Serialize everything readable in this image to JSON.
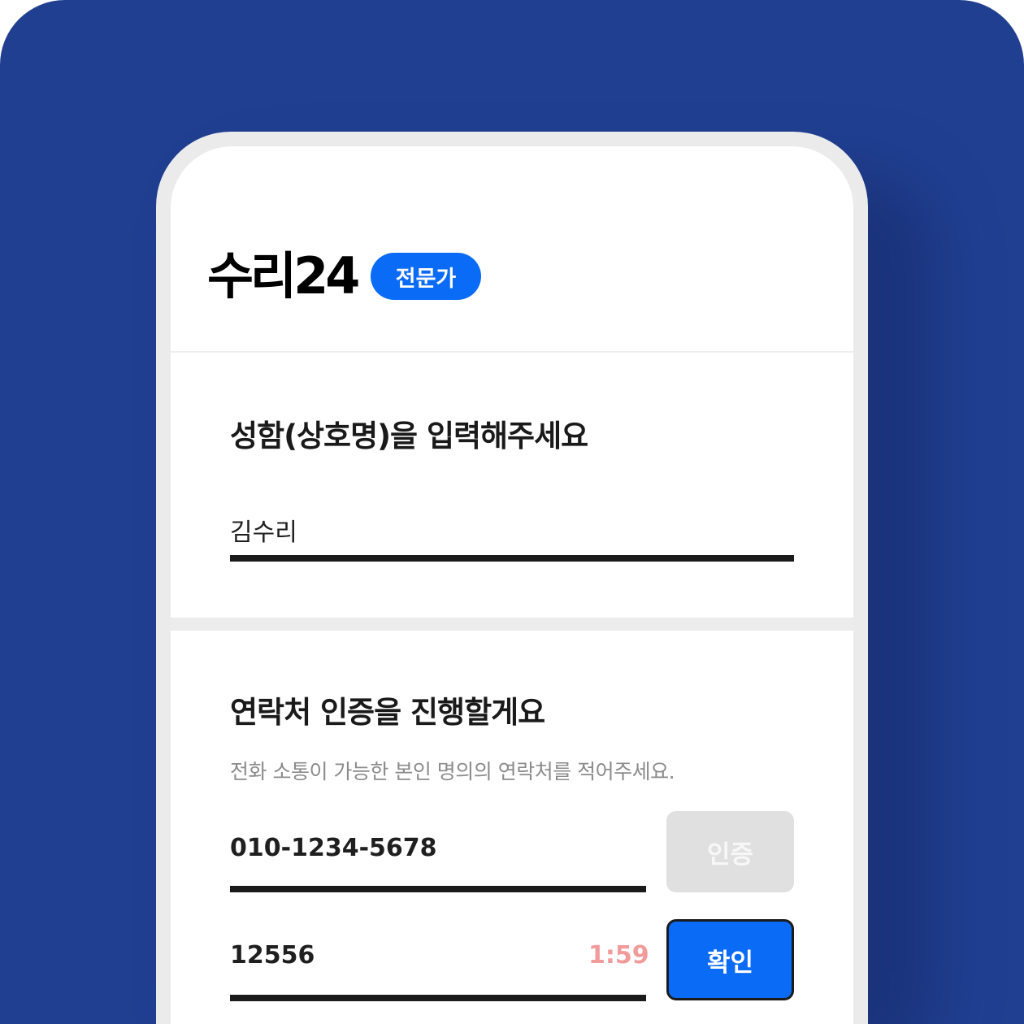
{
  "app": {
    "logo_text": "수리24",
    "badge": "전문가"
  },
  "name_section": {
    "title": "성함(상호명)을 입력해주세요",
    "value": "김수리"
  },
  "contact_section": {
    "title": "연락처 인증을 진행할게요",
    "hint": "전화 소통이 가능한 본인 명의의 연락처를 적어주세요.",
    "phone_value": "010-1234-5678",
    "verify_button": "인증",
    "code_value": "12556",
    "timer": "1:59",
    "confirm_button": "확인"
  },
  "colors": {
    "background": "#203f91",
    "accent": "#0a6bf7",
    "timer": "#f29b9b",
    "disabled_button": "#e0e0e0"
  }
}
